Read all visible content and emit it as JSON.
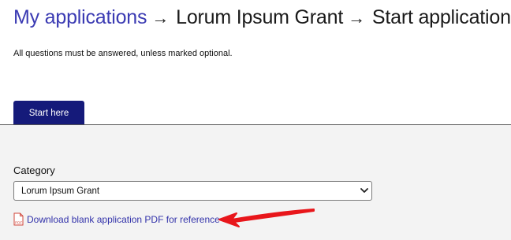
{
  "breadcrumb": {
    "items": [
      {
        "label": "My applications"
      },
      {
        "label": "Lorum Ipsum Grant"
      },
      {
        "label": "Start application"
      }
    ],
    "separator": "→"
  },
  "instructions": "All questions must be answered, unless marked optional.",
  "tabs": [
    {
      "label": "Start here",
      "active": true
    }
  ],
  "form": {
    "category": {
      "label": "Category",
      "value": "Lorum Ipsum Grant"
    }
  },
  "pdf_download": {
    "label": "Download blank application PDF for reference",
    "icon": "pdf-file-icon"
  },
  "colors": {
    "link": "#3b3bb3",
    "tab_bg": "#151a7a",
    "panel_bg": "#f3f3f3",
    "annotation_arrow": "#e8161b"
  }
}
